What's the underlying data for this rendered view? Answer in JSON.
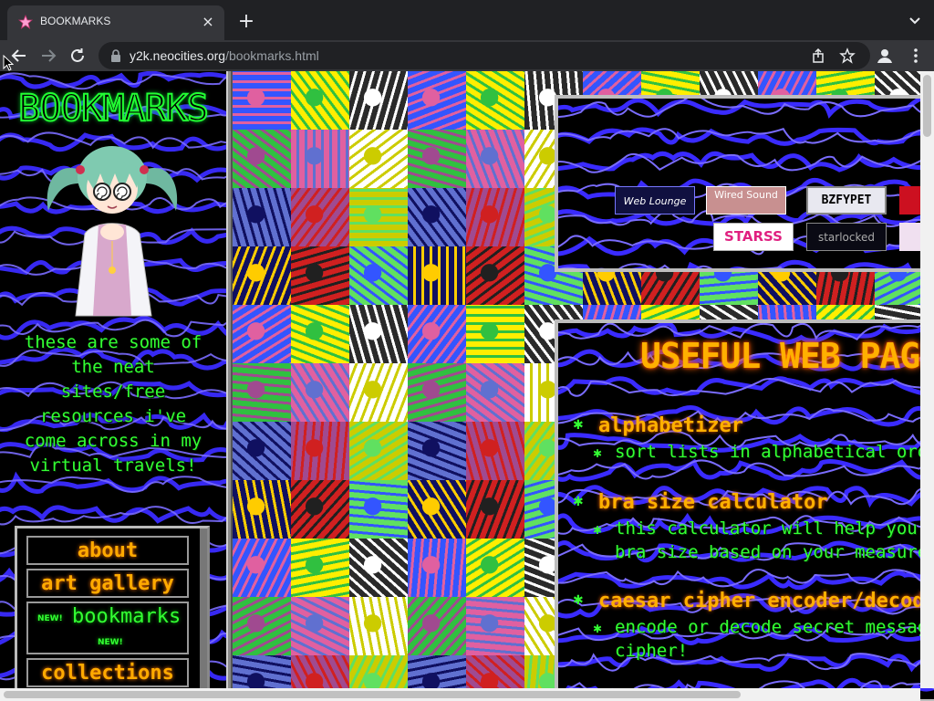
{
  "browser": {
    "tab_title": "BOOKMARKS",
    "url_host": "y2k.neocities.org",
    "url_path": "/bookmarks.html",
    "new_tab_label": "+",
    "close_label": "×"
  },
  "sidebar": {
    "title": "BOOKMARKS",
    "intro_text": "these are some of the neat sites/free resources i've come across in my virtual travels!",
    "nav": [
      {
        "label": "about"
      },
      {
        "label": "art gallery"
      },
      {
        "label": "bookmarks",
        "badge": "NEW!"
      },
      {
        "label": "collections"
      }
    ]
  },
  "buttons_panel": {
    "badges": [
      {
        "name": "web-lounge-button",
        "text": "Web Lounge"
      },
      {
        "name": "wired-sound-button",
        "text": "Wired Sound"
      },
      {
        "name": "bzfypet-button",
        "text": "BZFYPET"
      },
      {
        "name": "stars-button",
        "text": "STARSS"
      },
      {
        "name": "starlocked-button",
        "text": "starlocked"
      }
    ]
  },
  "useful_panel": {
    "title": "USEFUL WEB PAGES",
    "items": [
      {
        "title": "alphabetizer",
        "desc": "sort lists in alphabetical order"
      },
      {
        "title": "bra size calculator",
        "desc": "this calculator will help you\nbra size based on your measurements"
      },
      {
        "title": "caesar cipher encoder/decoder",
        "desc": "encode or decode secret messages\ncipher!"
      }
    ]
  },
  "colors": {
    "neon_green": "#33ff33",
    "neon_orange": "#ffb000",
    "swirl_blue": "#3322ff"
  }
}
